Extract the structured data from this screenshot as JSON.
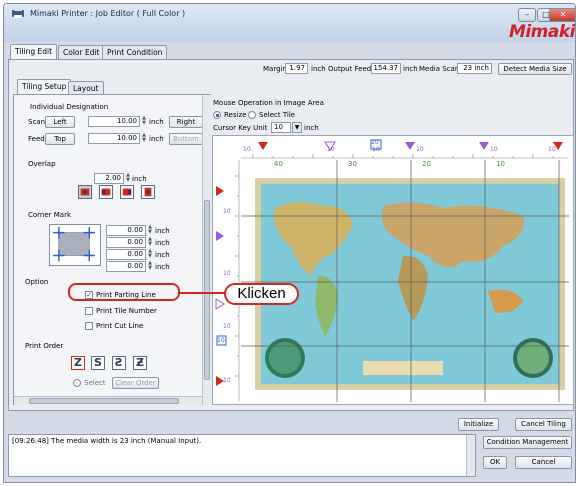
{
  "window": {
    "title": "Mimaki Printer : Job Editor ( Full Color )",
    "logo": "Mimaki",
    "controls": {
      "minimize": "–",
      "maximize": "□",
      "close": "✕"
    }
  },
  "main_tabs": [
    {
      "label": "Tiling Edit"
    },
    {
      "label": "Color Edit"
    },
    {
      "label": "Print Condition"
    }
  ],
  "media_bar": {
    "margin_label": "Margin",
    "margin_value": "1.97",
    "margin_unit": "inch",
    "output_feed_label": "Output Feed",
    "output_feed_value": "154.37",
    "output_feed_unit": "inch",
    "media_scan_label": "Media Scan",
    "media_scan_value": "23 inch",
    "detect_button": "Detect Media Size"
  },
  "sub_tabs": [
    {
      "label": "Tiling Setup"
    },
    {
      "label": "Layout"
    }
  ],
  "tiling_setup": {
    "individual_designation": "Individual Designation",
    "scan_label": "Scan",
    "scan_left_button": "Left",
    "scan_value": "10.00",
    "scan_unit": "inch",
    "scan_right_button": "Right",
    "feed_label": "Feed",
    "feed_top_button": "Top",
    "feed_value": "10.00",
    "feed_unit": "inch",
    "feed_bottom_button": "Bottom",
    "overlap_label": "Overlap",
    "overlap_value": "2.00",
    "overlap_unit": "inch",
    "corner_mark_label": "Corner Mark",
    "corner_values": [
      "0.00",
      "0.00",
      "0.00",
      "0.00"
    ],
    "corner_unit": "inch",
    "option_label": "Option",
    "option_print_parting_line": "Print Parting Line",
    "option_print_tile_number": "Print Tile Number",
    "option_print_cut_line": "Print Cut Line",
    "print_order_label": "Print Order",
    "print_order_select": "Select",
    "print_order_clear": "Clear Order"
  },
  "image_area": {
    "mouse_op_label": "Mouse Operation in Image Area",
    "resize_label": "Resize",
    "select_tile_label": "Select Tile",
    "cursor_key_label": "Cursor Key Unit",
    "cursor_key_value": "10",
    "cursor_key_unit": "inch",
    "top_ruler_marks": [
      "10",
      "10",
      "10",
      "10",
      "10",
      "10"
    ],
    "ruler_labels_top": [
      "40",
      "30",
      "20",
      "10"
    ],
    "side_marks": [
      "10",
      "10",
      "10",
      "10"
    ],
    "tile_number_badges": [
      "10",
      "10"
    ]
  },
  "bottom": {
    "initialize_button": "Initialize",
    "cancel_tiling_button": "Cancel Tiling",
    "log_message": "[09:26:48] The media width is 23 inch (Manual Input).",
    "condition_management_button": "Condition Management",
    "ok_button": "OK",
    "cancel_button": "Cancel"
  },
  "callout": {
    "text": "Klicken"
  },
  "colors": {
    "accent_red": "#d3261c",
    "purple_marker": "#9b59d6",
    "blue_marker": "#2b5fd9"
  }
}
